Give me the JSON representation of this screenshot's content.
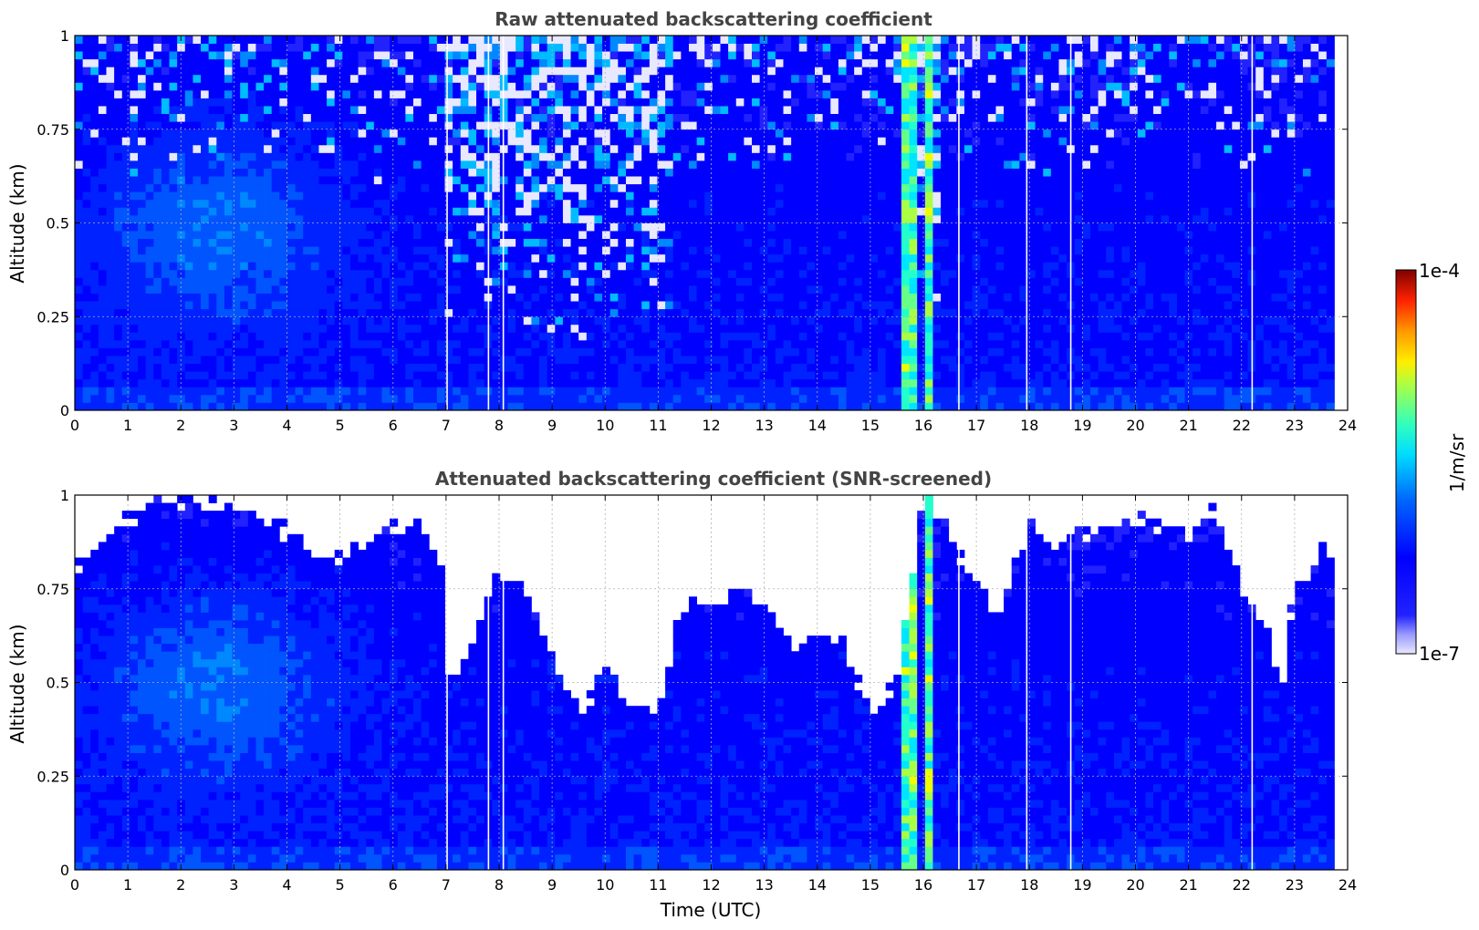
{
  "chart_data": [
    {
      "type": "heatmap",
      "title": "Raw attenuated backscattering coefficient",
      "xlabel": "",
      "ylabel": "Altitude (km)",
      "xlim": [
        0,
        24
      ],
      "ylim": [
        0,
        1
      ],
      "x_ticks": [
        "0",
        "1",
        "2",
        "3",
        "4",
        "5",
        "6",
        "7",
        "8",
        "9",
        "10",
        "11",
        "12",
        "13",
        "14",
        "15",
        "16",
        "17",
        "18",
        "19",
        "20",
        "21",
        "22",
        "23",
        "24"
      ],
      "y_ticks": [
        "0",
        "0.25",
        "0.5",
        "0.75",
        "1"
      ],
      "grid": true,
      "screened": false,
      "data_end_time": 23.75,
      "noisy_periods": [
        {
          "start": 7.0,
          "end": 11.3
        },
        {
          "start": 15.6,
          "end": 16.4
        }
      ],
      "aerosol_layer_top_km": 0.75,
      "strong_echo_periods": [
        {
          "start": 15.65,
          "end": 15.95
        },
        {
          "start": 16.05,
          "end": 16.25
        }
      ],
      "data_gaps_hours": [
        7.02,
        7.8,
        8.08,
        16.67,
        17.95,
        18.78,
        22.2
      ]
    },
    {
      "type": "heatmap",
      "title": "Attenuated backscattering coefficient (SNR-screened)",
      "xlabel": "Time (UTC)",
      "ylabel": "Altitude (km)",
      "xlim": [
        0,
        24
      ],
      "ylim": [
        0,
        1
      ],
      "x_ticks": [
        "0",
        "1",
        "2",
        "3",
        "4",
        "5",
        "6",
        "7",
        "8",
        "9",
        "10",
        "11",
        "12",
        "13",
        "14",
        "15",
        "16",
        "17",
        "18",
        "19",
        "20",
        "21",
        "22",
        "23",
        "24"
      ],
      "y_ticks": [
        "0",
        "0.25",
        "0.5",
        "0.75",
        "1"
      ],
      "grid": true,
      "screened": true,
      "data_end_time": 23.75,
      "valid_top_km": {
        "time": [
          0,
          0.5,
          1,
          1.5,
          2,
          2.5,
          3,
          3.5,
          4,
          4.5,
          5,
          5.5,
          6,
          6.5,
          7,
          7.05,
          7.5,
          8,
          8.5,
          9,
          9.5,
          10,
          10.5,
          11,
          11.5,
          12,
          12.5,
          13,
          13.5,
          14,
          14.5,
          15,
          15.5,
          16,
          16.5,
          17,
          17.5,
          18,
          18.5,
          19,
          19.5,
          20,
          20.5,
          21,
          21.5,
          22,
          22.5,
          22.75,
          23,
          23.5,
          23.75
        ],
        "altitude": [
          0.8,
          0.9,
          0.93,
          0.98,
          0.99,
          0.98,
          0.97,
          0.93,
          0.9,
          0.85,
          0.82,
          0.88,
          0.92,
          0.94,
          0.77,
          0.5,
          0.6,
          0.82,
          0.75,
          0.57,
          0.4,
          0.53,
          0.45,
          0.42,
          0.72,
          0.7,
          0.75,
          0.72,
          0.6,
          0.6,
          0.62,
          0.4,
          0.5,
          1.0,
          0.9,
          0.75,
          0.7,
          0.92,
          0.88,
          0.9,
          0.92,
          0.93,
          0.92,
          0.9,
          0.95,
          0.75,
          0.65,
          0.48,
          0.75,
          0.85,
          0.85
        ]
      },
      "data_gaps_hours": [
        7.02,
        7.8,
        8.08,
        16.67,
        17.95,
        18.78,
        22.2
      ]
    }
  ],
  "colorbar": {
    "label": "1/m/sr",
    "min_label": "1e-7",
    "max_label": "1e-4",
    "scale": "log",
    "colors": [
      "#e8e8ff",
      "#c8c8f8",
      "#9a9aff",
      "#6666ff",
      "#2222ff",
      "#0000ff",
      "#0022ff",
      "#0055ff",
      "#0088ff",
      "#00bbff",
      "#00e5ff",
      "#22ffcc",
      "#66ff88",
      "#aaff44",
      "#eeff00",
      "#ffcc00",
      "#ff8800",
      "#ff4400",
      "#dd0000",
      "#880000"
    ]
  }
}
